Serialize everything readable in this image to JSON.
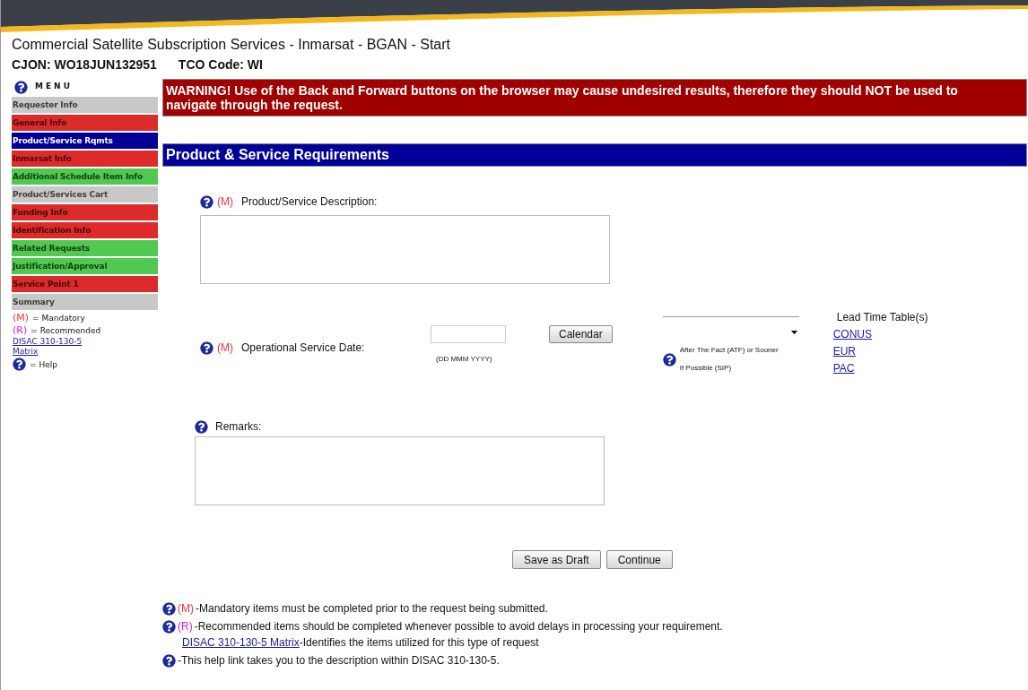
{
  "header": {
    "title": "Commercial Satellite Subscription Services - Inmarsat - BGAN - Start",
    "cjon": "CJON: WO18JUN132951",
    "tco": "TCO Code: WI"
  },
  "menu": {
    "title": "MENU",
    "items": [
      {
        "label": "Requester Info",
        "color": "#c8c8c8",
        "selected": false
      },
      {
        "label": "General Info",
        "color": "#dd2a2a",
        "selected": false
      },
      {
        "label": "Product/Service Rqmts",
        "color": "#000099",
        "selected": true
      },
      {
        "label": "Inmarsat Info",
        "color": "#dd2a2a",
        "selected": false
      },
      {
        "label": "Additional Schedule Item Info",
        "color": "#4fc94f",
        "selected": false
      },
      {
        "label": "Product/Services Cart",
        "color": "#c8c8c8",
        "selected": false
      },
      {
        "label": "Funding Info",
        "color": "#dd2a2a",
        "selected": false
      },
      {
        "label": "Identification Info",
        "color": "#dd2a2a",
        "selected": false
      },
      {
        "label": "Related Requests",
        "color": "#4fc94f",
        "selected": false
      },
      {
        "label": "Justification/Approval",
        "color": "#4fc94f",
        "selected": false
      },
      {
        "label": "Service Point 1",
        "color": "#dd2a2a",
        "selected": false
      },
      {
        "label": "Summary",
        "color": "#c8c8c8",
        "selected": false
      }
    ],
    "legend": {
      "mandatory_mark": "(M)",
      "mandatory": "= Mandatory",
      "recommended_mark": "(R)",
      "recommended": "= Recommended",
      "matrix_link": "DISAC 310-130-5 Matrix",
      "help": "= Help"
    }
  },
  "warning": "WARNING! Use of the Back and Forward buttons on the browser may cause undesired results, therefore they should NOT be used to navigate through the request.",
  "section_title": "Product & Service Requirements",
  "description": {
    "mark": "(M)",
    "label": "Product/Service Description:"
  },
  "service_date": {
    "mark": "(M)",
    "label": "Operational Service Date:",
    "format_hint": "(DD MMM YYYY)",
    "calendar_button": "Calendar",
    "atf_note": "After The Fact (ATF) or Sooner If Possible (SIP)"
  },
  "lead_time": {
    "title": "Lead Time Table(s)",
    "links": [
      "CONUS",
      "EUR",
      "PAC"
    ]
  },
  "remarks": {
    "label": "Remarks:"
  },
  "buttons": [
    "Save as Draft",
    "Continue"
  ],
  "notes": [
    {
      "kind": "mandatory",
      "mark": "(M)",
      "text": "-Mandatory items must be completed prior to the request being submitted."
    },
    {
      "kind": "recommended",
      "mark": "(R)",
      "text": "-Recommended items should be completed whenever possible to avoid delays in processing your requirement.",
      "link": "DISAC 310-130-5 Matrix",
      "link_text": "-Identifies the items utilized for this type of request"
    },
    {
      "kind": "help",
      "text": "-This help link takes you to the description within DISAC 310-130-5."
    }
  ]
}
